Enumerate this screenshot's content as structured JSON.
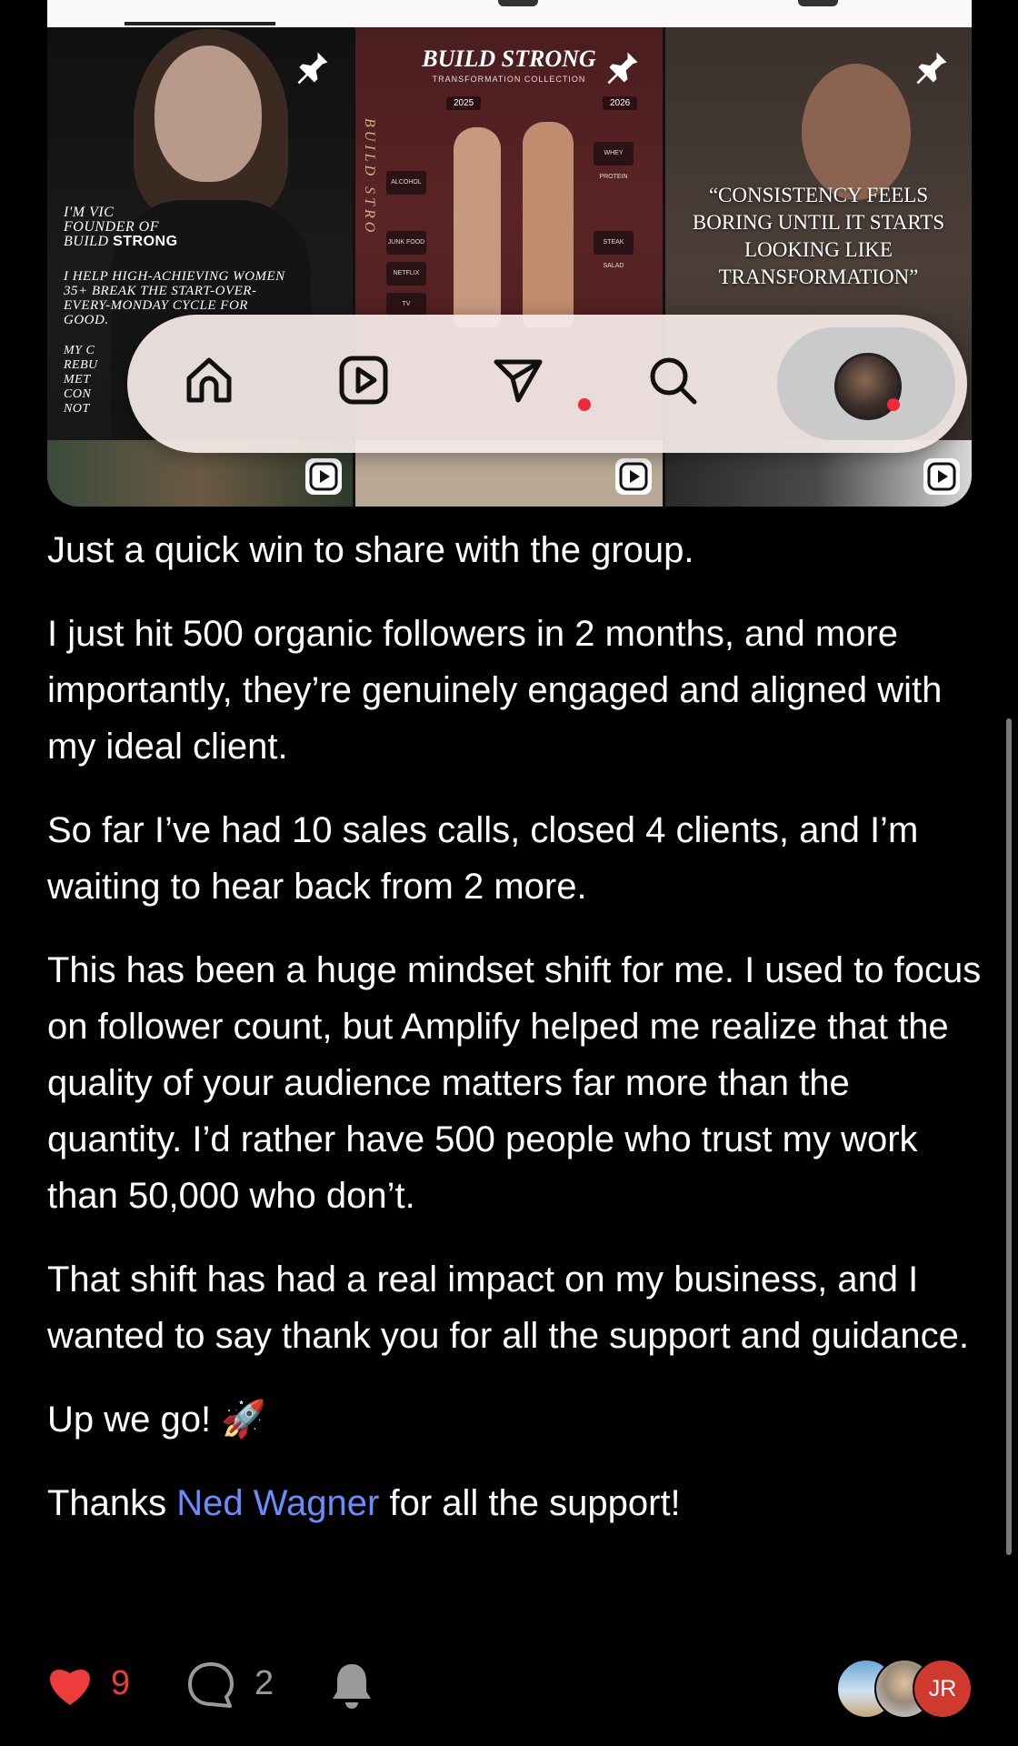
{
  "embed": {
    "tile1": {
      "intro_lines": [
        "I'M VIC",
        "FOUNDER OF"
      ],
      "brand_prefix": "BUILD",
      "brand_strong": "STRONG",
      "help_lines": [
        "I HELP HIGH-ACHIEVING WOMEN",
        "35+ BREAK THE START-OVER-",
        "EVERY-MONDAY CYCLE FOR",
        "GOOD."
      ],
      "cut_lines": [
        "MY C",
        "REBU",
        "MET",
        "CON",
        "NOT"
      ]
    },
    "tile2": {
      "title": "BUILD STRONG",
      "subtitle": "TRANSFORMATION COLLECTION",
      "year_left": "2025",
      "year_right": "2026",
      "side_text": "BUILD STRO",
      "shelf_labels": [
        "ALCOHOL",
        "JUNK FOOD",
        "NETFLIX",
        "TV"
      ],
      "right_labels": [
        "WHEY PROTEIN",
        "STEAK SALAD"
      ]
    },
    "tile3": {
      "quote_lines": [
        "“CONSISTENCY FEELS",
        "BORING UNTIL IT STARTS",
        "LOOKING LIKE",
        "TRANSFORMATION”"
      ]
    },
    "nav_icons": [
      "home-icon",
      "reels-icon",
      "send-icon",
      "search-icon",
      "profile-avatar"
    ]
  },
  "post": {
    "paragraphs": [
      "Just a quick win to share with the group.",
      "I just hit 500 organic followers in 2 months, and more importantly, they’re genuinely engaged and aligned with my ideal client.",
      "So far I’ve had 10 sales calls, closed 4 clients, and I’m waiting to hear back from 2 more.",
      "This has been a huge mindset shift for me. I used to focus on follower count, but Amplify helped me realize that the quality of your audience matters far more than the quantity. I’d rather have 500 people who trust my work than 50,000 who don’t.",
      "That shift has had a real impact on my business, and I wanted to say thank you for all the support and guidance.",
      "Up we go! 🚀"
    ],
    "thanks_prefix": "Thanks ",
    "mention": "Ned Wagner",
    "thanks_suffix": " for all the support!"
  },
  "footer": {
    "like_count": "9",
    "comment_count": "2",
    "avatar_initials": "JR"
  },
  "colors": {
    "background": "#000000",
    "mention": "#6b8cff",
    "like": "#ee3b3b",
    "avatar_jr": "#d03a2e"
  }
}
